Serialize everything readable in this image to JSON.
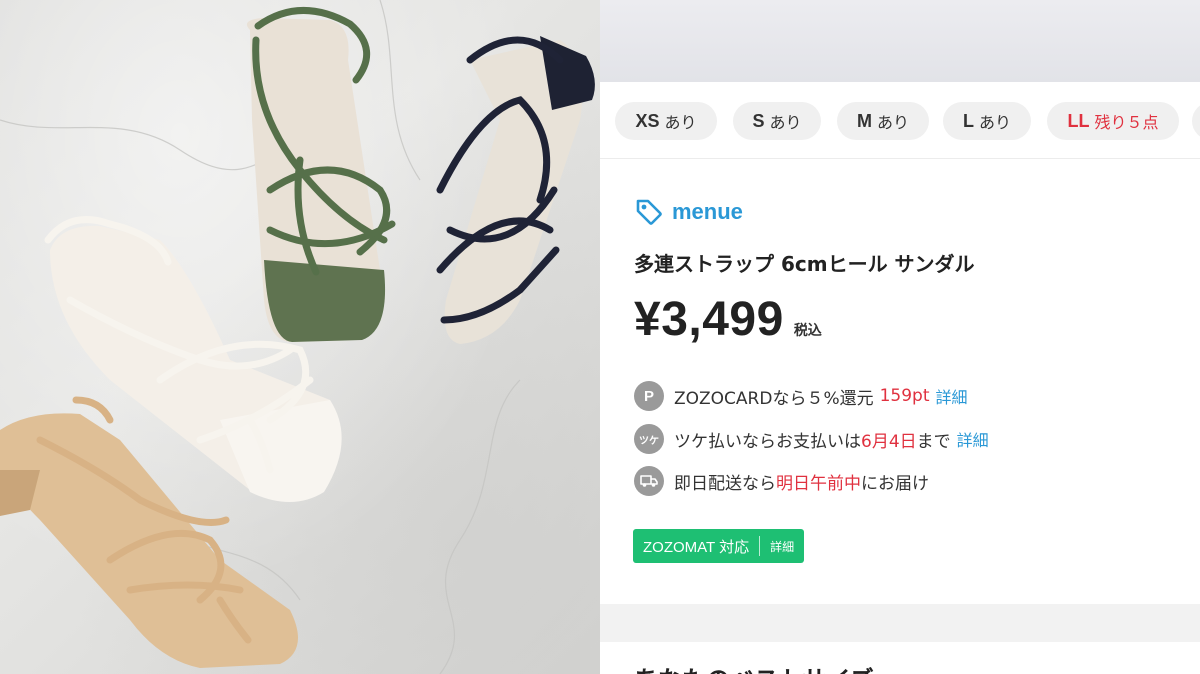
{
  "sizes": [
    {
      "size": "XS",
      "stock": "あり",
      "low": false
    },
    {
      "size": "S",
      "stock": "あり",
      "low": false
    },
    {
      "size": "M",
      "stock": "あり",
      "low": false
    },
    {
      "size": "L",
      "stock": "あり",
      "low": false
    },
    {
      "size": "LL",
      "stock": "残り５点",
      "low": true
    }
  ],
  "brand": {
    "name": "menue",
    "icon": "tag-icon"
  },
  "product": {
    "name": "多連ストラップ 6cmヒール サンダル",
    "price": "¥3,499",
    "tax_label": "税込"
  },
  "info": {
    "card": {
      "icon_text": "P",
      "prefix": "ZOZOCARDなら５%還元",
      "points": "159pt",
      "link": "詳細"
    },
    "tsuke": {
      "icon_text": "ツケ",
      "prefix": "ツケ払いならお支払いは",
      "date": "6月4日",
      "suffix": "まで",
      "link": "詳細"
    },
    "delivery": {
      "icon": "truck-icon",
      "prefix": "即日配送なら",
      "highlight": "明日午前中",
      "suffix": "にお届け"
    }
  },
  "zozomat": {
    "label": "ZOZOMAT 対応",
    "detail": "詳細"
  },
  "next_section_title": "あなたのベストサイズ",
  "colors": {
    "accent_blue": "#2a98d6",
    "accent_red": "#e0313f",
    "zozomat_green": "#1ebf73"
  }
}
